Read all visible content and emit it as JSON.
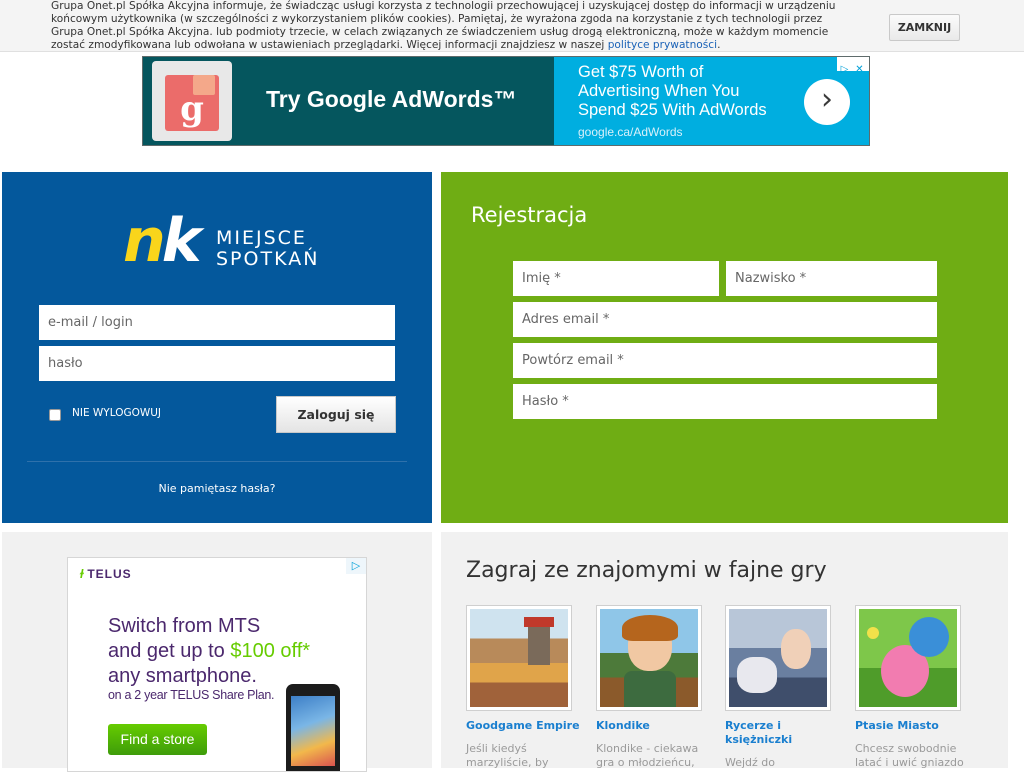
{
  "cookie_bar": {
    "text": "Grupa Onet.pl Spółka Akcyjna informuje, że świadcząc usługi korzysta z technologii przechowującej i uzyskującej dostęp do informacji w urządzeniu końcowym użytkownika (w szczególności z wykorzystaniem plików cookies). Pamiętaj, że wyrażona zgoda na korzystanie z tych technologii przez Grupa Onet.pl Spółka Akcyjna. lub podmioty trzecie, w celach związanych ze świadczeniem usług drogą elektroniczną, może w każdym momencie zostać zmodyfikowana lub odwołana w ustawieniach przeglądarki. Więcej informacji znajdziesz w naszej ",
    "link_text": "polityce prywatności",
    "after_link": ".",
    "close_label": "ZAMKNIJ"
  },
  "adwords_ad": {
    "headline": "Try Google AdWords™",
    "description": "Get $75 Worth of Advertising When You Spend $25 With AdWords",
    "url": "google.ca/AdWords",
    "arrow": "›",
    "logo_letter": "g",
    "choices_play": "▷",
    "choices_close": "✕"
  },
  "login": {
    "logo_n": "n",
    "logo_k": "k",
    "tagline_line1": "MIEJSCE",
    "tagline_line2": "SPOTKAŃ",
    "email_placeholder": "e-mail / login",
    "password_placeholder": "hasło",
    "remember_label": "NIE WYLOGOWUJ",
    "login_button": "Zaloguj się",
    "forgot_link": "Nie pamiętasz hasła?"
  },
  "register": {
    "title": "Rejestracja",
    "first_name_placeholder": "Imię *",
    "last_name_placeholder": "Nazwisko *",
    "email_placeholder": "Adres email *",
    "email_repeat_placeholder": "Powtórz email *",
    "password_placeholder": "Hasło *"
  },
  "telus_ad": {
    "logo": "TELUS",
    "logo_mark": "ɫ",
    "adchoice": "▷",
    "headline_line1": "Switch from MTS",
    "headline_line2_a": "and get up to ",
    "headline_line2_b": "$100 off",
    "headline_line2_c": "*",
    "headline_line3": "any smartphone.",
    "subline": "on a 2 year TELUS Share Plan.",
    "button": "Find a store"
  },
  "games": {
    "title": "Zagraj ze znajomymi w fajne gry",
    "items": [
      {
        "name": "Goodgame Empire",
        "desc": "Jeśli kiedyś marzyliście, by"
      },
      {
        "name": "Klondike",
        "desc": "Klondike - ciekawa gra o młodzieńcu,"
      },
      {
        "name": "Rycerze i księżniczki",
        "desc": "Wejdź do"
      },
      {
        "name": "Ptasie Miasto",
        "desc": "Chcesz swobodnie latać i uwić gniazdo"
      }
    ]
  },
  "colors": {
    "login_blue": "#04589c",
    "register_green": "#6fad14",
    "nk_yellow": "#f9d51b",
    "telus_purple": "#4b286d",
    "telus_green": "#66cc00",
    "game_link_blue": "#1a7fcf"
  }
}
